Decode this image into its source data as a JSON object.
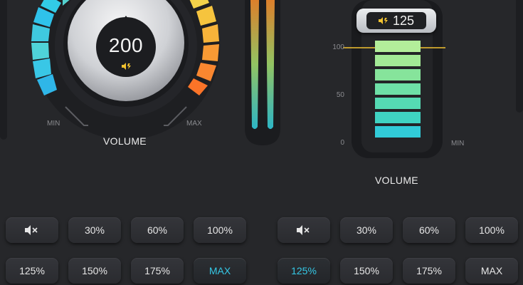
{
  "left_panel": {
    "knob_value": "200",
    "min_label": "MIN",
    "max_label": "MAX",
    "volume_label": "VOLUME"
  },
  "right_panel": {
    "badge_value": "125",
    "ticks": [
      "100",
      "50",
      "0"
    ],
    "min_label": "MIN",
    "volume_label": "VOLUME"
  },
  "left_presets": {
    "row1": [
      {
        "label": "",
        "icon": "mute-icon"
      },
      {
        "label": "30%"
      },
      {
        "label": "60%"
      },
      {
        "label": "100%"
      }
    ],
    "row2": [
      {
        "label": "125%"
      },
      {
        "label": "150%"
      },
      {
        "label": "175%"
      },
      {
        "label": "MAX",
        "active": true
      }
    ]
  },
  "right_presets": {
    "row1": [
      {
        "label": "",
        "icon": "mute-icon"
      },
      {
        "label": "30%"
      },
      {
        "label": "60%"
      },
      {
        "label": "100%"
      }
    ],
    "row2": [
      {
        "label": "125%",
        "active": true
      },
      {
        "label": "150%"
      },
      {
        "label": "175%"
      },
      {
        "label": "MAX"
      }
    ]
  },
  "colors": {
    "background": "#26272a",
    "accent_cyan": "#35c8e6",
    "accent_yellow": "#f2c230",
    "accent_orange": "#ff7a2a"
  }
}
